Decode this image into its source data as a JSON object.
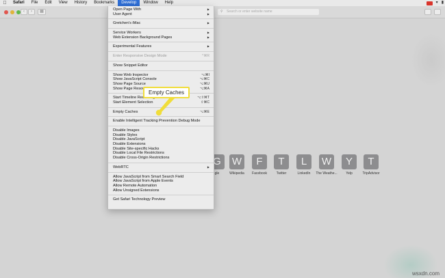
{
  "menubar": {
    "apple_icon": "apple-icon",
    "items": [
      {
        "label": "Safari"
      },
      {
        "label": "File"
      },
      {
        "label": "Edit"
      },
      {
        "label": "View"
      },
      {
        "label": "History"
      },
      {
        "label": "Bookmarks"
      },
      {
        "label": "Develop"
      },
      {
        "label": "Window"
      },
      {
        "label": "Help"
      }
    ],
    "active_item": "Develop",
    "active_color": "#2f6fd6"
  },
  "toolbar": {
    "back_label": "‹",
    "forward_label": "›",
    "sidebar_icon": "sidebar-icon",
    "address_placeholder": "Search or enter website name",
    "search_icon": "search-icon"
  },
  "develop_menu": {
    "items": [
      {
        "label": "Open Page With",
        "submenu": true
      },
      {
        "label": "User Agent",
        "submenu": true
      },
      {
        "sep": true
      },
      {
        "label": "Gretchen's iMac",
        "submenu": true
      },
      {
        "sep": true
      },
      {
        "label": "Service Workers",
        "submenu": true
      },
      {
        "label": "Web Extension Background Pages",
        "submenu": true
      },
      {
        "sep": true
      },
      {
        "label": "Experimental Features",
        "submenu": true
      },
      {
        "sep": true
      },
      {
        "label": "Enter Responsive Design Mode",
        "shortcut": "^⌘R",
        "disabled": true
      },
      {
        "sep": true
      },
      {
        "label": "Show Snippet Editor"
      },
      {
        "sep": true
      },
      {
        "label": "Show Web Inspector",
        "shortcut": "⌥⌘I"
      },
      {
        "label": "Show JavaScript Console",
        "shortcut": "⌥⌘C"
      },
      {
        "label": "Show Page Source",
        "shortcut": "⌥⌘U"
      },
      {
        "label": "Show Page Resources",
        "shortcut": "⌥⌘A"
      },
      {
        "sep": true
      },
      {
        "label": "Start Timeline Recording",
        "shortcut": "⌥⇧⌘T"
      },
      {
        "label": "Start Element Selection",
        "shortcut": "⇧⌘C"
      },
      {
        "sep": true
      },
      {
        "label": "Empty Caches",
        "shortcut": "⌥⌘E"
      },
      {
        "sep": true
      },
      {
        "label": "Enable Intelligent Tracking Prevention Debug Mode"
      },
      {
        "sep": true
      },
      {
        "label": "Disable Images"
      },
      {
        "label": "Disable Styles"
      },
      {
        "label": "Disable JavaScript"
      },
      {
        "label": "Disable Extensions"
      },
      {
        "label": "Disable Site-specific Hacks"
      },
      {
        "label": "Disable Local File Restrictions"
      },
      {
        "label": "Disable Cross-Origin Restrictions"
      },
      {
        "sep": true
      },
      {
        "label": "WebRTC",
        "submenu": true
      },
      {
        "sep": true
      },
      {
        "label": "Allow JavaScript from Smart Search Field"
      },
      {
        "label": "Allow JavaScript from Apple Events"
      },
      {
        "label": "Allow Remote Automation"
      },
      {
        "label": "Allow Unsigned Extensions"
      },
      {
        "sep": true
      },
      {
        "label": "Get Safari Technology Preview"
      }
    ]
  },
  "callout": {
    "label": "Empty Caches",
    "border_color": "#f0dd3a",
    "dot_color": "#f0dd3a"
  },
  "favorites": [
    {
      "letter": "G",
      "label": "gle"
    },
    {
      "letter": "W",
      "label": "Wikipedia"
    },
    {
      "letter": "F",
      "label": "Facebook"
    },
    {
      "letter": "T",
      "label": "Twitter"
    },
    {
      "letter": "L",
      "label": "LinkedIn"
    },
    {
      "letter": "W",
      "label": "The Weathe..."
    },
    {
      "letter": "Y",
      "label": "Yelp"
    },
    {
      "letter": "T",
      "label": "TripAdvisor"
    }
  ],
  "watermark": "wsxdn.com"
}
